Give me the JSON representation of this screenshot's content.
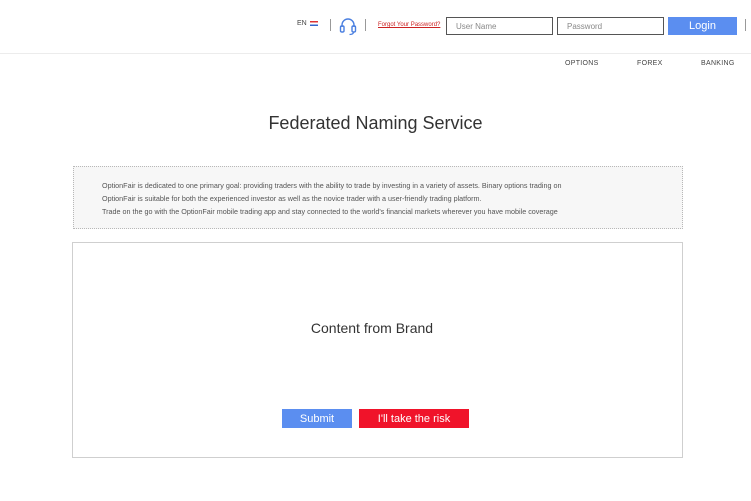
{
  "header": {
    "language": "EN",
    "forgot_password": "Forgot Your Password?",
    "username_placeholder": "User Name",
    "password_placeholder": "Password",
    "login_label": "Login",
    "colors": {
      "login_button": "#5b8ef0",
      "forgot_link": "#cc2222"
    }
  },
  "nav": {
    "items": [
      "OPTIONS",
      "FOREX",
      "BANKING"
    ]
  },
  "page": {
    "title": "Federated Naming Service"
  },
  "info": {
    "lines": [
      "OptionFair is dedicated to one primary goal: providing traders with the ability to trade by investing in a variety of assets. Binary options trading on",
      "OptionFair is suitable for both the experienced investor as well as the novice trader with a user-friendly trading platform.",
      "Trade on the go with the OptionFair mobile trading app and stay connected to the world's financial markets wherever you have mobile coverage"
    ]
  },
  "content": {
    "brand_text": "Content from Brand",
    "submit_label": "Submit",
    "risk_label": "I'll take the risk",
    "colors": {
      "submit": "#5b8ef0",
      "risk": "#f0132a"
    }
  }
}
